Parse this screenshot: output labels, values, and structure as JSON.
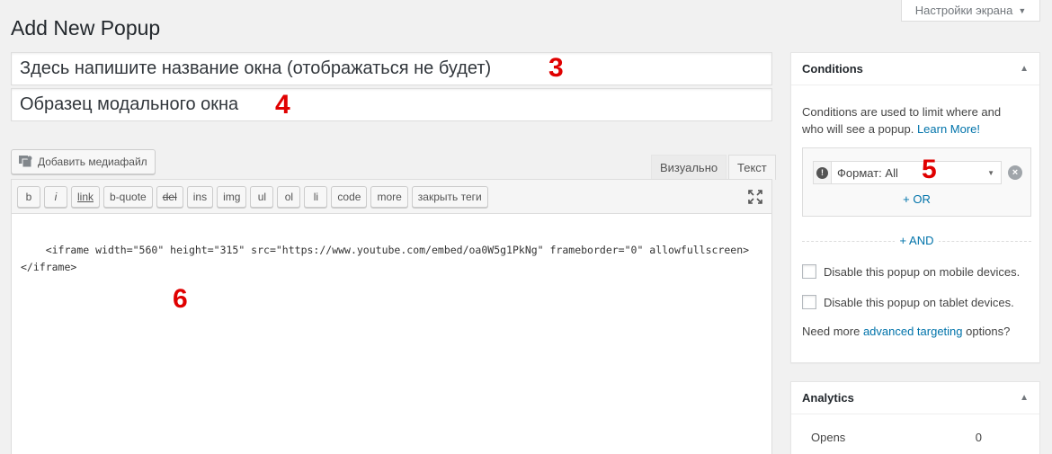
{
  "screen_options": {
    "label": "Настройки экрана",
    "arrow": "▼"
  },
  "page_title": "Add New Popup",
  "title_inputs": {
    "name_value": "Здесь напишите название окна (отображаться не будет)",
    "name_annotation": "3",
    "display_value": "Образец модального окна",
    "display_annotation": "4"
  },
  "editor": {
    "media_button_label": "Добавить медиафайл",
    "tab_visual": "Визуально",
    "tab_text": "Текст",
    "toolbar": [
      "b",
      "i",
      "link",
      "b-quote",
      "del",
      "ins",
      "img",
      "ul",
      "ol",
      "li",
      "code",
      "more",
      "закрыть теги"
    ],
    "content": "<iframe width=\"560\" height=\"315\" src=\"https://www.youtube.com/embed/oa0W5g1PkNg\" frameborder=\"0\" allowfullscreen>\n</iframe>",
    "annotation": "6"
  },
  "conditions": {
    "title": "Conditions",
    "desc_text": "Conditions are used to limit where and who will see a popup.",
    "desc_link": "Learn More!",
    "select_value": "Формат: All",
    "annotation": "5",
    "or_label": "+ OR",
    "and_label": "+ AND",
    "mobile_label": "Disable this popup on mobile devices.",
    "tablet_label": "Disable this popup on tablet devices.",
    "more_prefix": "Need more",
    "more_link": "advanced targeting",
    "more_suffix": "options?"
  },
  "analytics": {
    "title": "Analytics",
    "opens_label": "Opens",
    "opens_value": "0"
  },
  "colors": {
    "accent": "#0073aa",
    "annotation": "#e00000",
    "background": "#f1f1f1"
  }
}
